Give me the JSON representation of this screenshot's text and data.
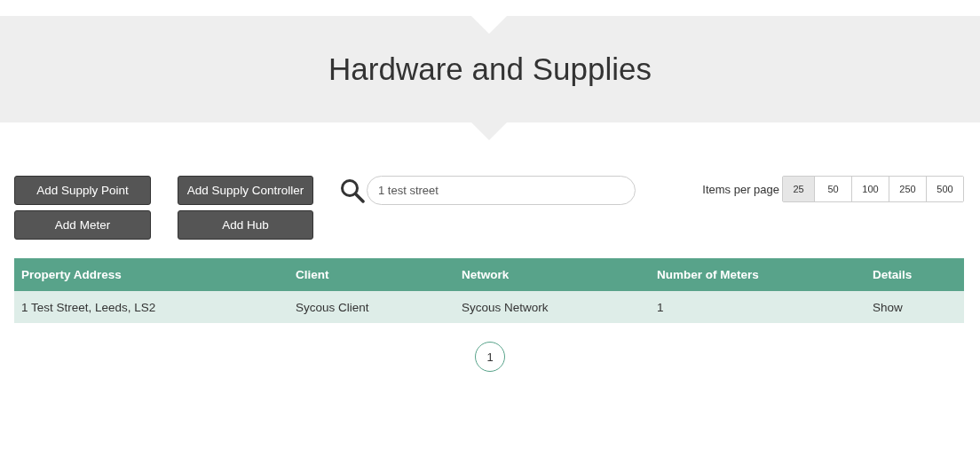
{
  "header": {
    "title": "Hardware and Supplies"
  },
  "buttons": [
    {
      "label": "Add Supply Point"
    },
    {
      "label": "Add Supply Controller"
    },
    {
      "label": "Add Meter"
    },
    {
      "label": "Add Hub"
    }
  ],
  "search": {
    "value": "1 test street"
  },
  "page_size": {
    "label": "Items per page",
    "options": [
      {
        "label": "25",
        "selected": true
      },
      {
        "label": "50",
        "selected": false
      },
      {
        "label": "100",
        "selected": false
      },
      {
        "label": "250",
        "selected": false
      },
      {
        "label": "500",
        "selected": false
      }
    ]
  },
  "table": {
    "columns": [
      "Property Address",
      "Client",
      "Network",
      "Number of Meters",
      "Details"
    ],
    "rows": [
      {
        "cells": [
          "1 Test Street, Leeds, LS2",
          "Sycous Client",
          "Sycous Network",
          "1",
          "Show"
        ]
      }
    ]
  },
  "pagination": [
    {
      "label": "1",
      "selected": true
    }
  ]
}
